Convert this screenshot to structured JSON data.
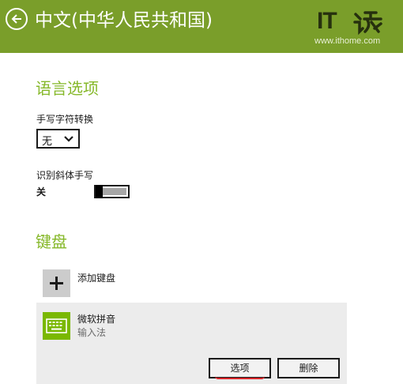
{
  "header": {
    "title": "中文(中华人民共和国)",
    "logo_text": "IT",
    "logo_url": "www.ithome.com",
    "color": "#7a9e2a"
  },
  "language_options": {
    "heading": "语言选项",
    "handwriting_conversion": {
      "label": "手写字符转换",
      "selected_value": "无"
    },
    "italic_handwriting": {
      "label": "识别斜体手写",
      "state_text": "关",
      "enabled": false
    }
  },
  "keyboards": {
    "heading": "键盘",
    "add_keyboard_label": "添加键盘",
    "items": [
      {
        "name": "微软拼音",
        "subtitle": "输入法",
        "icon": "keyboard-icon",
        "options_label": "选项",
        "remove_label": "删除"
      }
    ]
  },
  "colors": {
    "accent_green": "#86b82a",
    "tile_green": "#7ab800",
    "underline_red": "#d9262a"
  }
}
